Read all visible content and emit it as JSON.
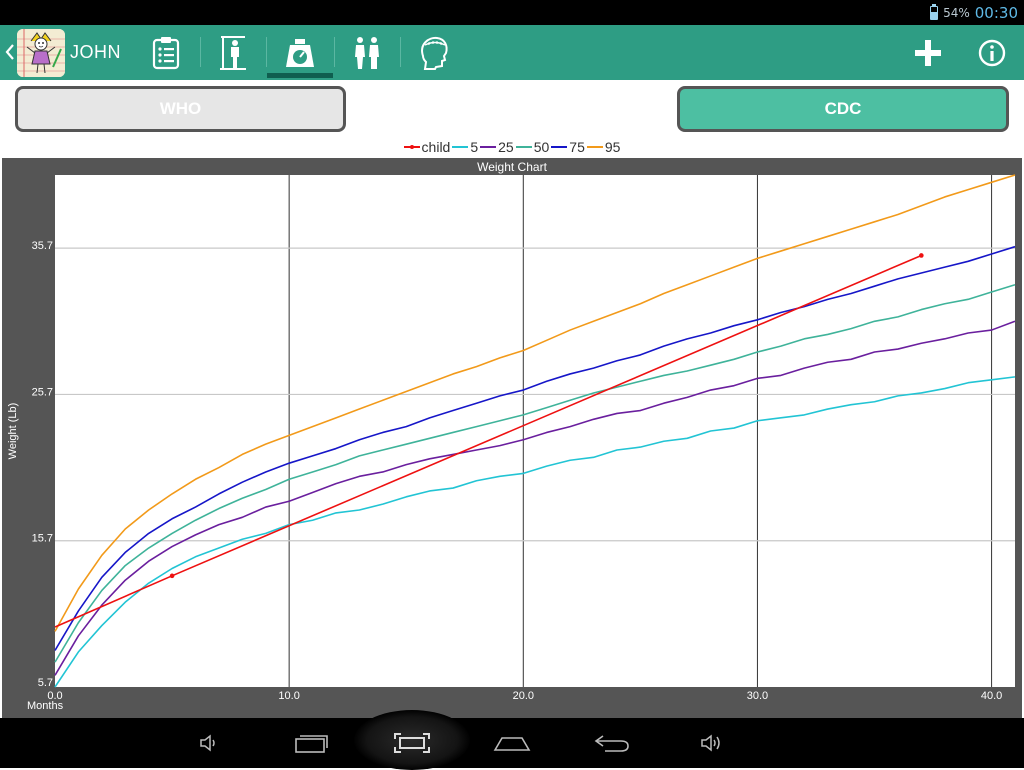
{
  "status_bar": {
    "battery_percent": "54%",
    "clock": "00:30",
    "battery_icon": "battery-icon"
  },
  "action_bar": {
    "patient_name": "JOHN",
    "tabs": [
      {
        "icon": "clipboard-icon",
        "selected": false
      },
      {
        "icon": "height-measure-icon",
        "selected": false
      },
      {
        "icon": "weighing-scale-icon",
        "selected": true
      },
      {
        "icon": "body-figures-icon",
        "selected": false
      },
      {
        "icon": "head-circumference-icon",
        "selected": false
      }
    ],
    "actions": [
      {
        "icon": "plus-icon"
      },
      {
        "icon": "info-icon"
      }
    ]
  },
  "standard_buttons": {
    "who_label": "WHO",
    "cdc_label": "CDC",
    "selected": "CDC"
  },
  "legend": [
    {
      "label": "child",
      "color": "#ee1111"
    },
    {
      "label": "5",
      "color": "#22c4d4"
    },
    {
      "label": "25",
      "color": "#6a1f9e"
    },
    {
      "label": "50",
      "color": "#3fb39a"
    },
    {
      "label": "75",
      "color": "#1616c8"
    },
    {
      "label": "95",
      "color": "#f29a1a"
    }
  ],
  "chart_data": {
    "type": "line",
    "title": "Weight Chart",
    "xlabel": "Months",
    "ylabel": "Weight (Lb)",
    "xlim": [
      0,
      41
    ],
    "ylim": [
      5.7,
      40.7
    ],
    "x_ticks": [
      "0.0",
      "10.0",
      "20.0",
      "30.0",
      "40.0"
    ],
    "y_ticks": [
      "5.7",
      "15.7",
      "25.7",
      "35.7"
    ],
    "x": [
      0,
      1,
      2,
      3,
      4,
      5,
      6,
      7,
      8,
      9,
      10,
      11,
      12,
      13,
      14,
      15,
      16,
      17,
      18,
      19,
      20,
      21,
      22,
      23,
      24,
      25,
      26,
      27,
      28,
      29,
      30,
      31,
      32,
      33,
      34,
      35,
      36,
      37,
      38,
      39,
      40,
      41
    ],
    "series": [
      {
        "name": "child",
        "x": [
          0,
          5,
          37
        ],
        "values": [
          9.8,
          13.3,
          35.2
        ]
      },
      {
        "name": "5",
        "values": [
          5.7,
          8.1,
          9.9,
          11.5,
          12.8,
          13.8,
          14.6,
          15.2,
          15.8,
          16.2,
          16.8,
          17.1,
          17.6,
          17.8,
          18.2,
          18.7,
          19.1,
          19.3,
          19.8,
          20.1,
          20.3,
          20.8,
          21.2,
          21.4,
          21.9,
          22.1,
          22.5,
          22.7,
          23.2,
          23.4,
          23.9,
          24.1,
          24.3,
          24.7,
          25.0,
          25.2,
          25.6,
          25.8,
          26.1,
          26.5,
          26.7,
          26.9
        ]
      },
      {
        "name": "25",
        "values": [
          6.5,
          9.2,
          11.3,
          13.0,
          14.3,
          15.3,
          16.1,
          16.8,
          17.3,
          18.0,
          18.4,
          19.0,
          19.6,
          20.1,
          20.4,
          20.9,
          21.3,
          21.6,
          21.9,
          22.2,
          22.6,
          23.1,
          23.5,
          24.0,
          24.4,
          24.6,
          25.1,
          25.5,
          26.0,
          26.3,
          26.8,
          27.0,
          27.5,
          27.9,
          28.1,
          28.6,
          28.8,
          29.2,
          29.5,
          29.9,
          30.1,
          30.7
        ]
      },
      {
        "name": "50",
        "values": [
          7.4,
          10.1,
          12.3,
          14.0,
          15.2,
          16.2,
          17.1,
          17.9,
          18.6,
          19.2,
          19.9,
          20.4,
          20.9,
          21.5,
          21.9,
          22.3,
          22.7,
          23.1,
          23.5,
          23.9,
          24.3,
          24.8,
          25.3,
          25.8,
          26.2,
          26.6,
          27.0,
          27.3,
          27.7,
          28.1,
          28.6,
          29.0,
          29.5,
          29.8,
          30.2,
          30.7,
          31.0,
          31.5,
          31.9,
          32.2,
          32.7,
          33.2
        ]
      },
      {
        "name": "75",
        "values": [
          8.2,
          10.9,
          13.2,
          14.9,
          16.2,
          17.2,
          18.0,
          18.9,
          19.7,
          20.4,
          21.0,
          21.5,
          22.0,
          22.6,
          23.1,
          23.5,
          24.1,
          24.6,
          25.1,
          25.6,
          26.0,
          26.6,
          27.1,
          27.5,
          28.0,
          28.4,
          29.0,
          29.5,
          29.9,
          30.4,
          30.8,
          31.3,
          31.7,
          32.2,
          32.6,
          33.1,
          33.6,
          34.0,
          34.4,
          34.8,
          35.3,
          35.8
        ]
      },
      {
        "name": "95",
        "values": [
          9.5,
          12.4,
          14.7,
          16.5,
          17.8,
          18.9,
          19.9,
          20.7,
          21.6,
          22.3,
          22.9,
          23.5,
          24.1,
          24.7,
          25.3,
          25.9,
          26.5,
          27.1,
          27.6,
          28.2,
          28.7,
          29.4,
          30.1,
          30.7,
          31.3,
          31.9,
          32.6,
          33.2,
          33.8,
          34.4,
          35.0,
          35.5,
          36.0,
          36.5,
          37.0,
          37.5,
          38.0,
          38.6,
          39.2,
          39.7,
          40.2,
          40.7
        ]
      }
    ],
    "grid": true,
    "legend_position": "top-center"
  },
  "nav_bar": {
    "buttons": [
      {
        "icon": "volume-down-icon"
      },
      {
        "icon": "recent-apps-icon"
      },
      {
        "icon": "screenshot-icon"
      },
      {
        "icon": "home-icon"
      },
      {
        "icon": "back-icon"
      },
      {
        "icon": "volume-up-icon"
      }
    ]
  }
}
